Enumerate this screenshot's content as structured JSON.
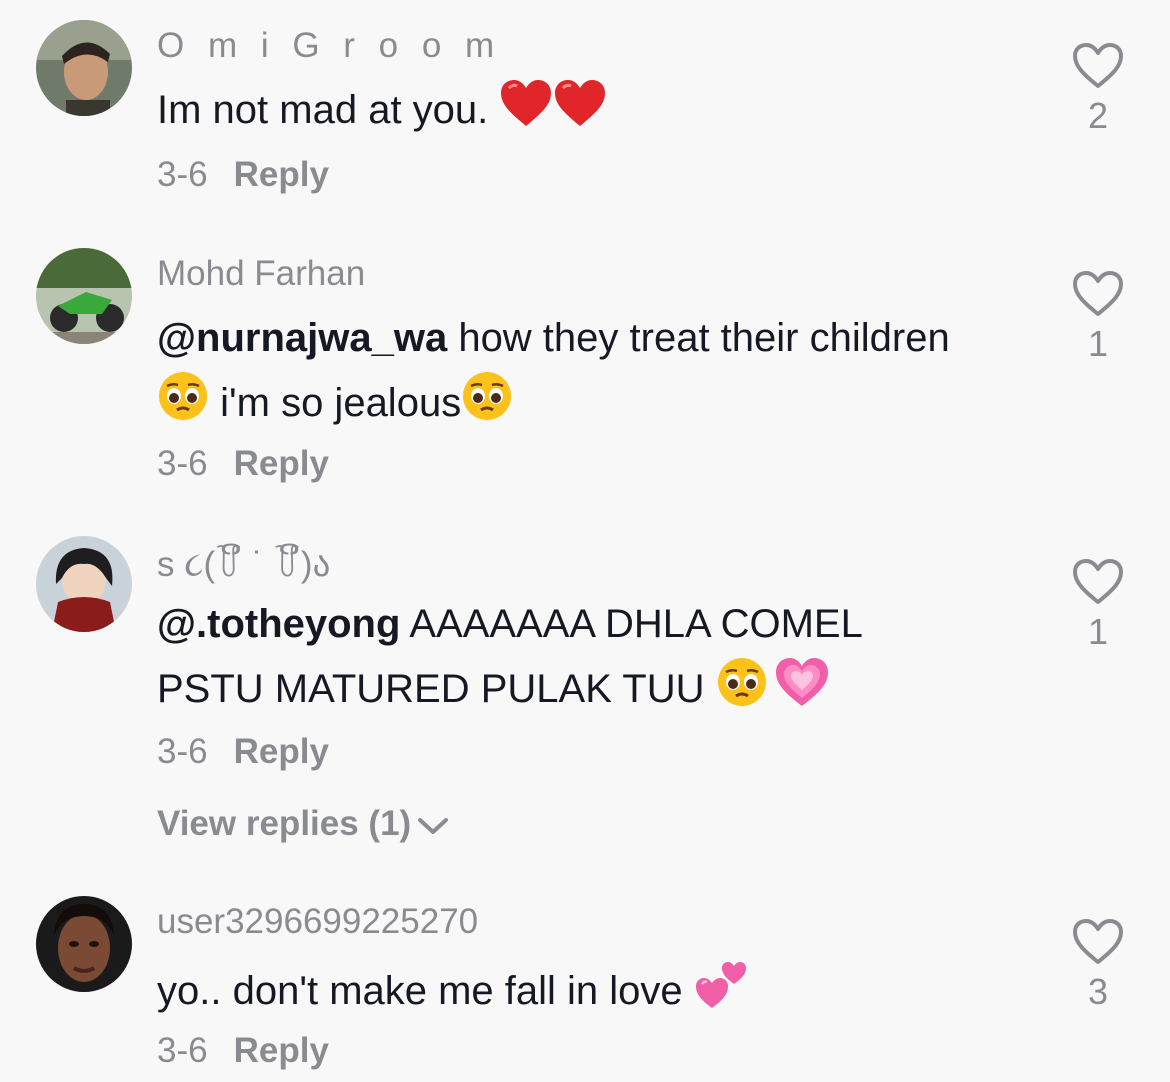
{
  "comments": [
    {
      "username": "O m i G r o o m",
      "text": "Im not mad at you.",
      "date": "3-6",
      "reply_label": "Reply",
      "likes": "2"
    },
    {
      "username": "Mohd Farhan",
      "mention": "@nurnajwa_wa",
      "text_a": " how they treat their children",
      "text_b": " i'm so jealous",
      "date": "3-6",
      "reply_label": "Reply",
      "likes": "1"
    },
    {
      "username": "s ૮(꒦ິ ˙ ꒦ິ)ა",
      "mention": "@.totheyong",
      "text": " AAAAAAA DHLA COMEL PSTU MATURED PULAK TUU ",
      "date": "3-6",
      "reply_label": "Reply",
      "view_replies": "View replies (1)",
      "likes": "1"
    },
    {
      "username": "user3296699225270",
      "text": "yo.. don't make me fall in love ",
      "date": "3-6",
      "reply_label": "Reply",
      "likes": "3"
    }
  ],
  "colors": {
    "background": "#f8f8f8",
    "text": "#161823",
    "muted": "#8a8b91",
    "heart_emoji": "#e0262a",
    "pink_heart": "#f05fa8"
  },
  "icons": {
    "like": "heart-outline-icon",
    "expand": "chevron-down-icon"
  }
}
